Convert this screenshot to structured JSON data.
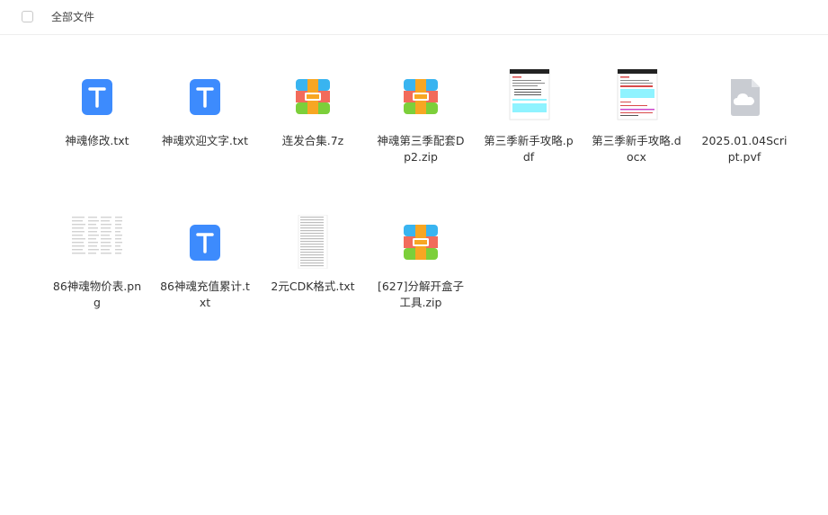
{
  "header": {
    "breadcrumb": "全部文件"
  },
  "files": [
    {
      "name": "神魂修改.txt",
      "icon": "txt-file-icon"
    },
    {
      "name": "神魂欢迎文字.txt",
      "icon": "txt-file-icon"
    },
    {
      "name": "连发合集.7z",
      "icon": "archive-file-icon"
    },
    {
      "name": "神魂第三季配套Dp2.zip",
      "icon": "archive-file-icon"
    },
    {
      "name": "第三季新手攻略.pdf",
      "icon": "pdf-thumbnail"
    },
    {
      "name": "第三季新手攻略.docx",
      "icon": "docx-thumbnail"
    },
    {
      "name": "2025.01.04Script.pvf",
      "icon": "cloud-file-icon"
    },
    {
      "name": "86神魂物价表.png",
      "icon": "image-thumbnail"
    },
    {
      "name": "86神魂充值累计.txt",
      "icon": "txt-file-icon"
    },
    {
      "name": "2元CDK格式.txt",
      "icon": "txt-thumbnail"
    },
    {
      "name": "[627]分解开盒子工具.zip",
      "icon": "archive-file-icon"
    }
  ],
  "colors": {
    "txt_icon": "#3d8bfd",
    "archive_top": "#39b4f0",
    "archive_mid": "#f26b5b",
    "archive_bottom": "#7ccf3a",
    "archive_strap": "#f7a623",
    "cloud_icon": "#c9ccd2",
    "highlight_cyan": "#8ff3ff"
  }
}
